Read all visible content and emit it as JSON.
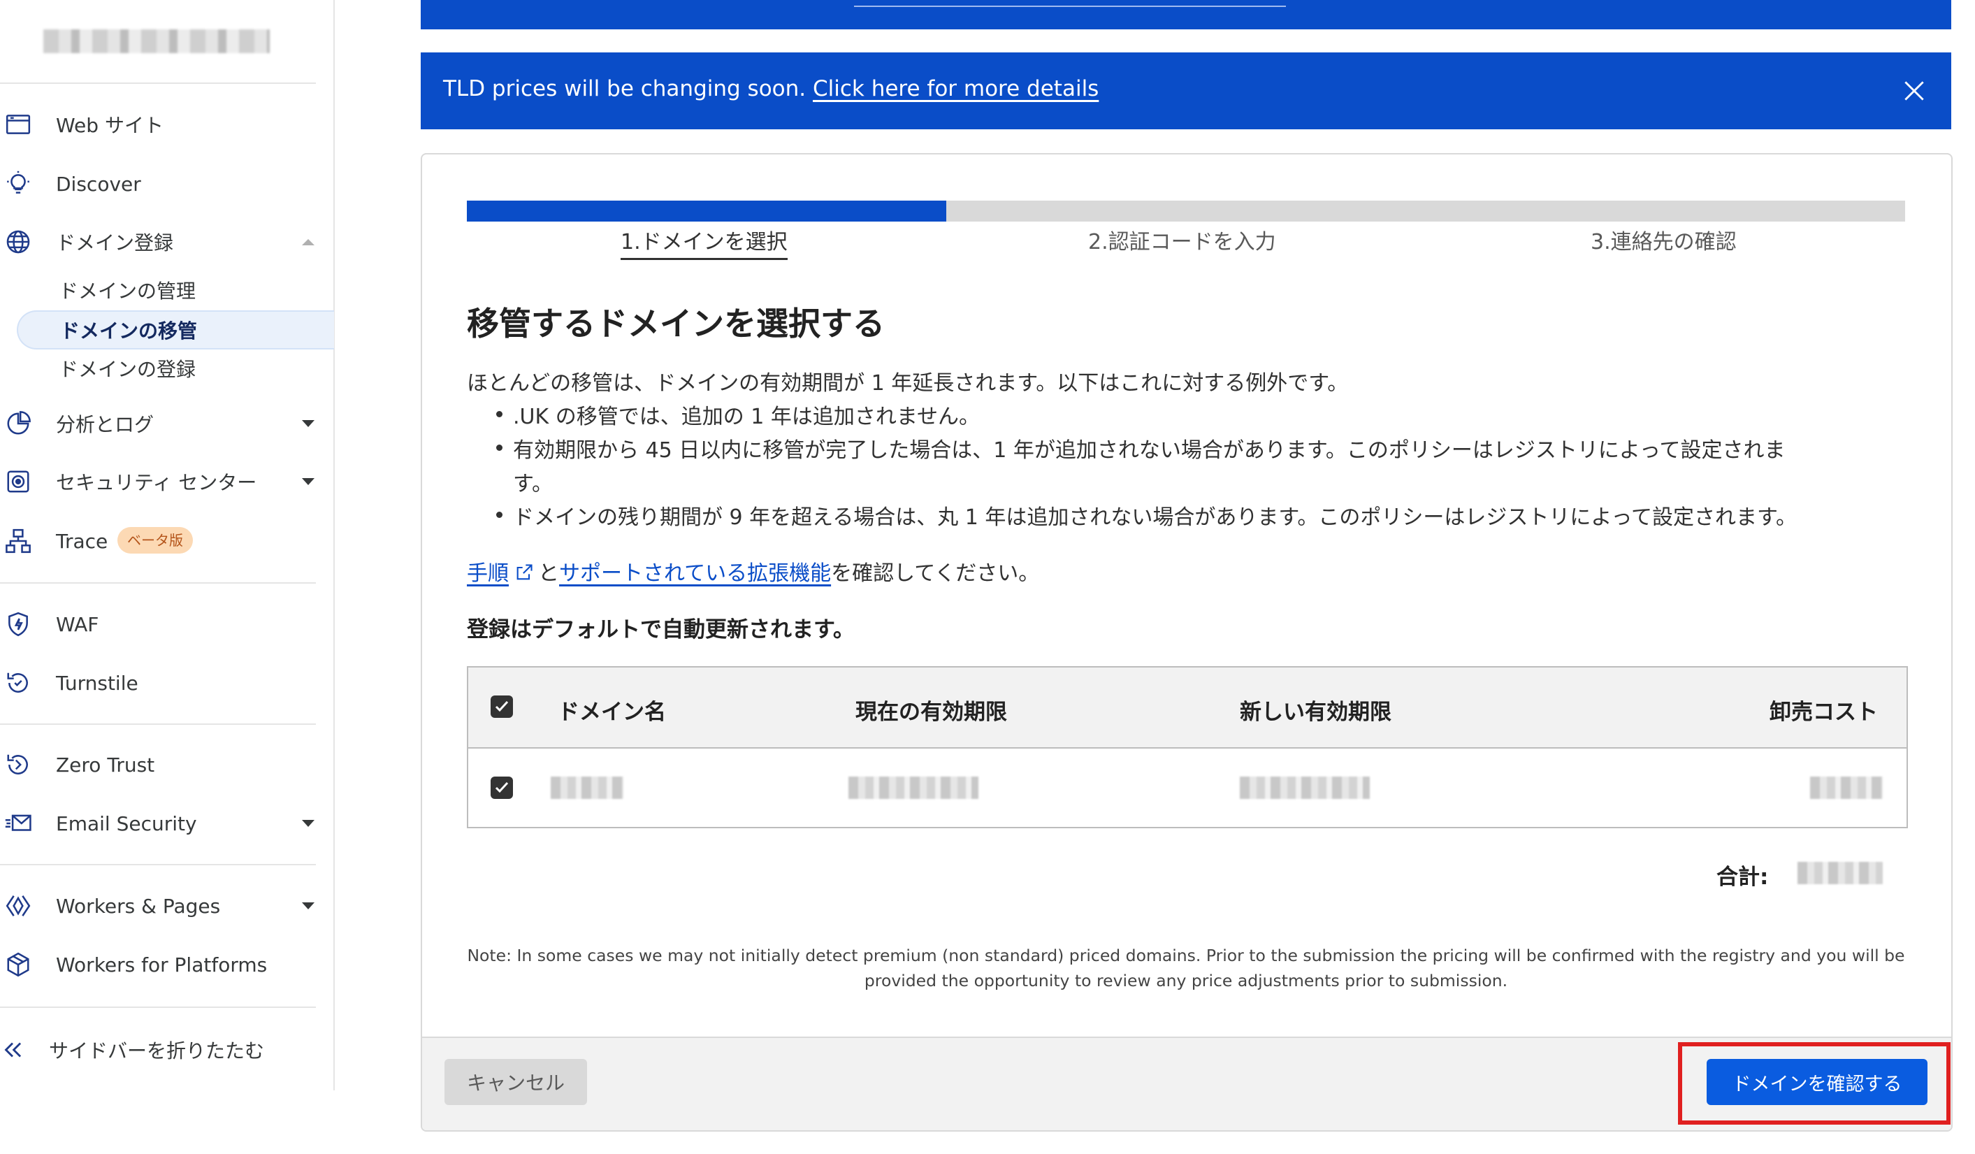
{
  "sidebar": {
    "items": [
      {
        "label": "Web サイト",
        "icon": "browser-window-icon"
      },
      {
        "label": "Discover",
        "icon": "lightbulb-icon"
      },
      {
        "label": "ドメイン登録",
        "icon": "globe-icon",
        "expanded": true
      },
      {
        "label": "分析とログ",
        "icon": "pie-chart-icon"
      },
      {
        "label": "セキュリティ センター",
        "icon": "security-center-icon"
      },
      {
        "label": "Trace",
        "icon": "sitemap-icon",
        "badge": "ベータ版"
      },
      {
        "label": "WAF",
        "icon": "shield-bolt-icon"
      },
      {
        "label": "Turnstile",
        "icon": "turnstile-icon"
      },
      {
        "label": "Zero Trust",
        "icon": "zero-trust-icon"
      },
      {
        "label": "Email Security",
        "icon": "email-icon"
      },
      {
        "label": "Workers & Pages",
        "icon": "workers-icon"
      },
      {
        "label": "Workers for Platforms",
        "icon": "package-icon"
      }
    ],
    "sub_items": [
      {
        "label": "ドメインの管理"
      },
      {
        "label": "ドメインの移管",
        "active": true
      },
      {
        "label": "ドメインの登録"
      }
    ],
    "collapse_label": "サイドバーを折りたたむ"
  },
  "banner": {
    "text": "TLD prices will be changing soon. ",
    "link": "Click here for more details"
  },
  "wizard": {
    "progress": 0.3333,
    "steps": [
      "1.ドメインを選択",
      "2.認証コードを入力",
      "3.連絡先の確認"
    ],
    "active_step": 1,
    "heading": "移管するドメインを選択する",
    "intro": "ほとんどの移管は、ドメインの有効期間が 1 年延長されます。以下はこれに対する例外です。",
    "bullets": [
      ".UK の移管では、追加の 1 年は追加されません。",
      "有効期限から 45 日以内に移管が完了した場合は、1 年が追加されない場合があります。このポリシーはレジストリによって設定されま",
      "す。",
      "ドメインの残り期間が 9 年を超える場合は、丸 1 年は追加されない場合があります。このポリシーはレジストリによって設定されます。"
    ],
    "links_line": {
      "link1": "手順",
      "mid": "と",
      "link2": "サポートされている拡張機能",
      "tail": "を確認してください。"
    },
    "auto_renew_note": "登録はデフォルトで自動更新されます。",
    "table": {
      "columns": [
        "ドメイン名",
        "現在の有効期限",
        "新しい有効期限",
        "卸売コスト"
      ]
    },
    "total_label": "合計:",
    "note": "Note: In some cases we may not initially detect premium (non standard) priced domains. Prior to the submission the pricing will be confirmed with the registry and you will be provided the opportunity to review any price adjustments prior to submission.",
    "cancel_label": "キャンセル",
    "confirm_label": "ドメインを確認する"
  },
  "colors": {
    "brand_blue": "#0a4dc8",
    "button_blue": "#0a5ce0",
    "highlight_red": "#e02020",
    "badge_bg": "#fcd9b4"
  }
}
